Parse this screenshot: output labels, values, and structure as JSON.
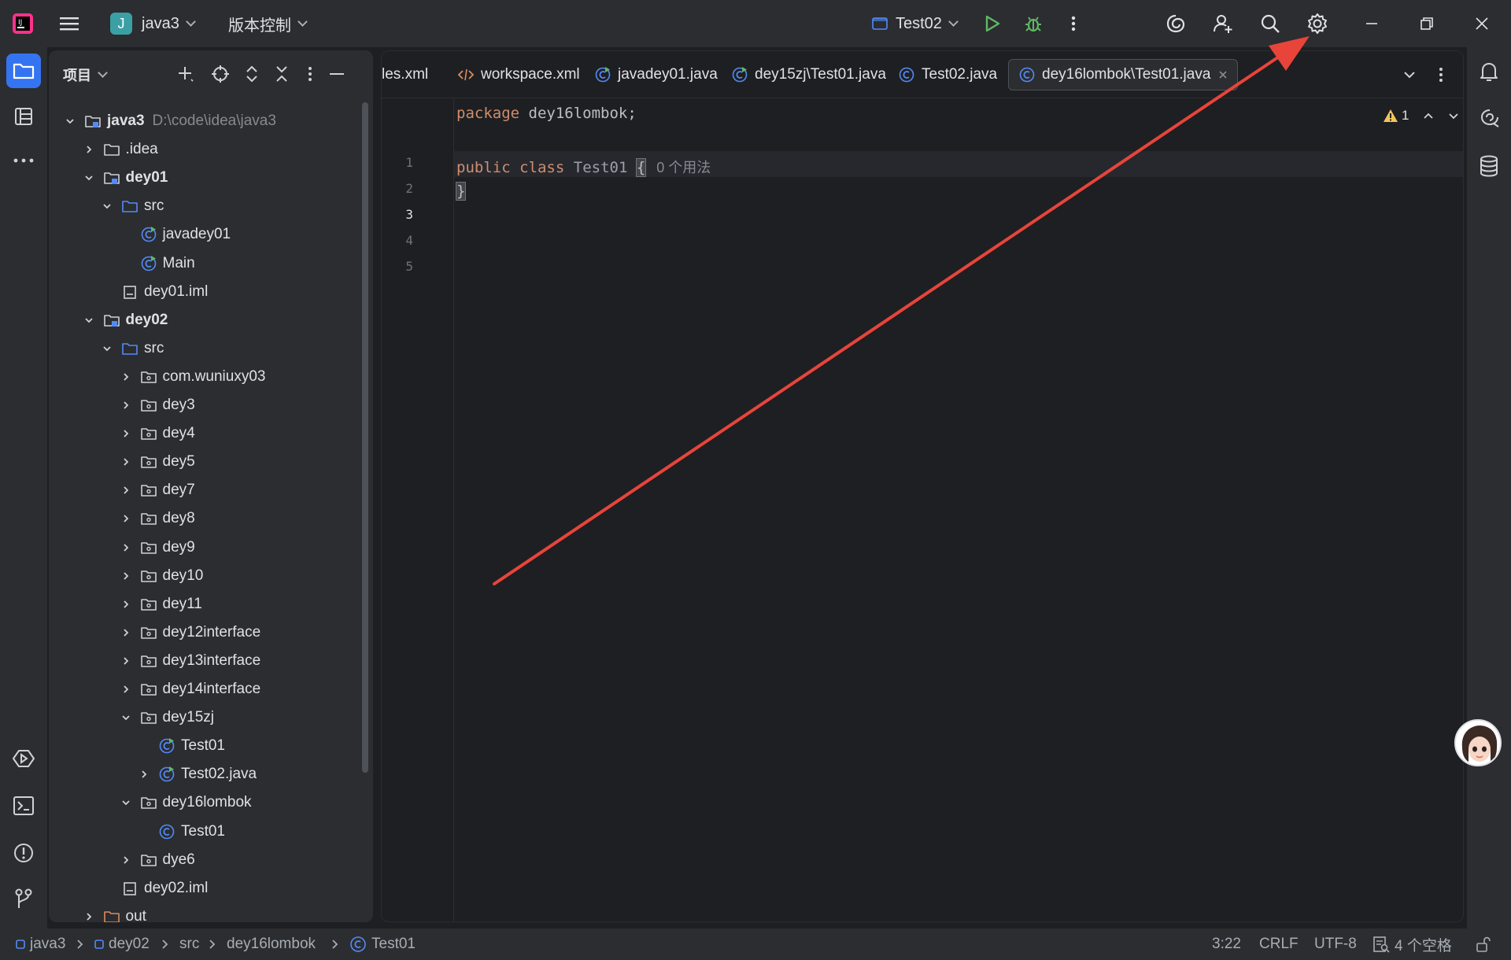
{
  "titlebar": {
    "project_initial": "J",
    "project_name": "java3",
    "vcs_label": "版本控制",
    "run_config": "Test02"
  },
  "project_panel": {
    "title": "项目",
    "tree": [
      {
        "label": "java3",
        "path": "D:\\code\\idea\\java3",
        "bold": true,
        "type": "module",
        "expanded": true
      },
      {
        "label": ".idea",
        "type": "folder",
        "expanded": false
      },
      {
        "label": "dey01",
        "bold": true,
        "type": "module",
        "expanded": true
      },
      {
        "label": "src",
        "type": "src",
        "expanded": true
      },
      {
        "label": "javadey01",
        "type": "class-run"
      },
      {
        "label": "Main",
        "type": "class-run"
      },
      {
        "label": "dey01.iml",
        "type": "file"
      },
      {
        "label": "dey02",
        "bold": true,
        "type": "module",
        "expanded": true
      },
      {
        "label": "src",
        "type": "src",
        "expanded": true
      },
      {
        "label": "com.wuniuxy03",
        "type": "package",
        "expanded": false
      },
      {
        "label": "dey3",
        "type": "package",
        "expanded": false
      },
      {
        "label": "dey4",
        "type": "package",
        "expanded": false
      },
      {
        "label": "dey5",
        "type": "package",
        "expanded": false
      },
      {
        "label": "dey7",
        "type": "package",
        "expanded": false
      },
      {
        "label": "dey8",
        "type": "package",
        "expanded": false
      },
      {
        "label": "dey9",
        "type": "package",
        "expanded": false
      },
      {
        "label": "dey10",
        "type": "package",
        "expanded": false
      },
      {
        "label": "dey11",
        "type": "package",
        "expanded": false
      },
      {
        "label": "dey12interface",
        "type": "package",
        "expanded": false
      },
      {
        "label": "dey13interface",
        "type": "package",
        "expanded": false
      },
      {
        "label": "dey14interface",
        "type": "package",
        "expanded": false
      },
      {
        "label": "dey15zj",
        "type": "package",
        "expanded": true
      },
      {
        "label": "Test01",
        "type": "class-run"
      },
      {
        "label": "Test02.java",
        "type": "class-run",
        "expanded": false
      },
      {
        "label": "dey16lombok",
        "type": "package",
        "expanded": true
      },
      {
        "label": "Test01",
        "type": "class"
      },
      {
        "label": "dye6",
        "type": "package",
        "expanded": false
      },
      {
        "label": "dey02.iml",
        "type": "file"
      },
      {
        "label": "out",
        "type": "folder-out",
        "expanded": false
      }
    ]
  },
  "editor": {
    "tabs": [
      {
        "label": "les.xml",
        "type": "xml"
      },
      {
        "label": "workspace.xml",
        "type": "xml-code"
      },
      {
        "label": "javadey01.java",
        "type": "class-run"
      },
      {
        "label": "dey15zj\\Test01.java",
        "type": "class-run"
      },
      {
        "label": "Test02.java",
        "type": "class"
      },
      {
        "label": "dey16lombok\\Test01.java",
        "type": "class",
        "active": true
      }
    ],
    "warning_count": "1",
    "line_numbers": [
      "1",
      "2",
      "3",
      "4",
      "5"
    ],
    "code": {
      "line1_kw": "package",
      "line1_rest": " dey16lombok;",
      "line3_kw1": "public",
      "line3_kw2": "class",
      "line3_name": "Test01",
      "line3_brace": "{",
      "line3_hint": "0 个用法",
      "line4_brace": "}"
    }
  },
  "statusbar": {
    "crumbs": [
      "java3",
      "dey02",
      "src",
      "dey16lombok",
      "Test01"
    ],
    "position": "3:22",
    "line_ending": "CRLF",
    "encoding": "UTF-8",
    "indent": "4 个空格"
  },
  "colors": {
    "accent": "#3574f0",
    "annotation_arrow": "#e8443a",
    "keyword": "#cf8e6d",
    "run_green": "#5fb865",
    "warning": "#f2c55c"
  }
}
